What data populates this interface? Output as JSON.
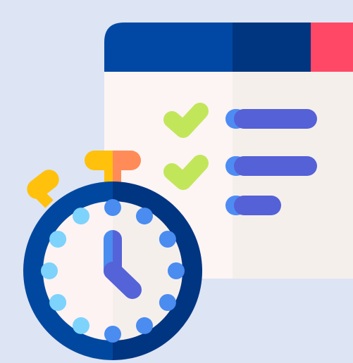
{
  "colors": {
    "background": "#dde4f4",
    "header_left": "#0048a3",
    "header_right": "#003580",
    "header_accent": "#ff4865",
    "panel_left": "#fdf4f4",
    "panel_right": "#f5efec",
    "check": "#c2e65a",
    "line_dark": "#5561d6",
    "line_light": "#4e8cf3",
    "bell_top_left": "#ffc10c",
    "bell_top_right": "#ff8c58",
    "watch_ring_left": "#00489f",
    "watch_ring_right": "#003582",
    "watch_face_left": "#fdf3f3",
    "watch_face_right": "#f5efec",
    "tick_light": "#7dd3fb",
    "tick_blue": "#4a8cf0",
    "hands": "#5563d8"
  },
  "icons": {
    "main": "checklist-stopwatch-icon",
    "checks": [
      "checkmark-icon",
      "checkmark-icon"
    ],
    "timer": "stopwatch-icon"
  },
  "checklist": {
    "rows": [
      {
        "checked": true,
        "length": "long"
      },
      {
        "checked": true,
        "length": "long"
      },
      {
        "checked": false,
        "length": "short"
      }
    ]
  }
}
